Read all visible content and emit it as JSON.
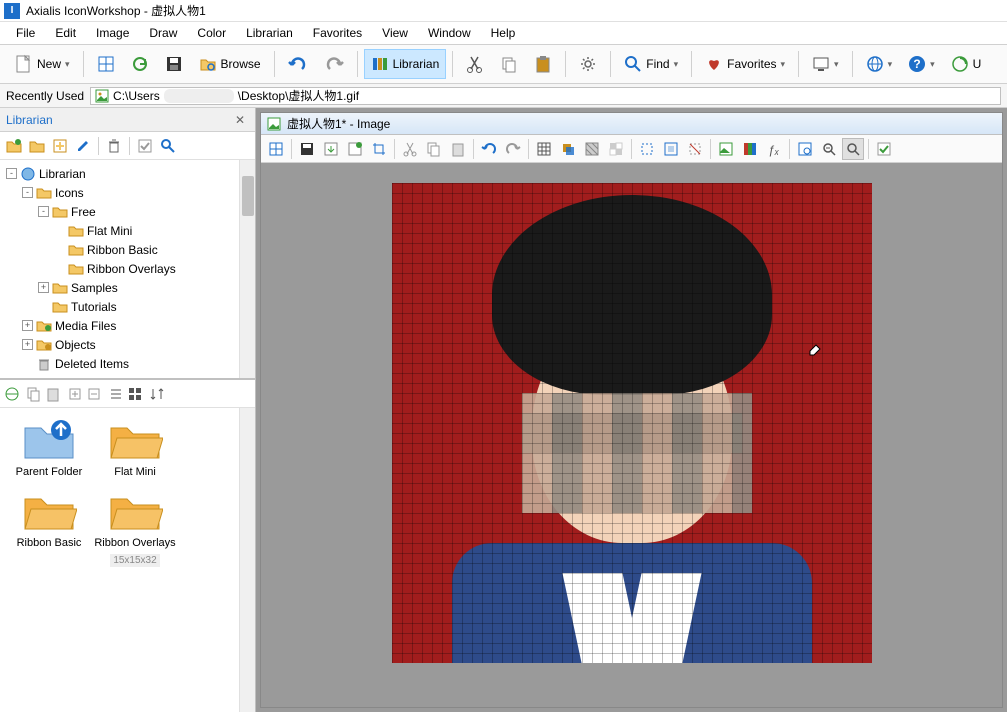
{
  "app": {
    "name": "Axialis IconWorkshop",
    "doc": "虚拟人物1"
  },
  "menu": [
    "File",
    "Edit",
    "Image",
    "Draw",
    "Color",
    "Librarian",
    "Favorites",
    "View",
    "Window",
    "Help"
  ],
  "toolbar": {
    "new": "New",
    "browse": "Browse",
    "librarian": "Librarian",
    "find": "Find",
    "favorites": "Favorites",
    "u_cut": "U"
  },
  "recent": {
    "label": "Recently Used",
    "path_prefix": "C:\\Users",
    "path_suffix": "\\Desktop\\虚拟人物1.gif"
  },
  "librarian": {
    "title": "Librarian",
    "tree": [
      {
        "depth": 0,
        "exp": "-",
        "icon": "lib",
        "label": "Librarian"
      },
      {
        "depth": 1,
        "exp": "-",
        "icon": "fold-y",
        "label": "Icons"
      },
      {
        "depth": 2,
        "exp": "-",
        "icon": "fold-y",
        "label": "Free"
      },
      {
        "depth": 3,
        "exp": "",
        "icon": "fold-y",
        "label": "Flat Mini"
      },
      {
        "depth": 3,
        "exp": "",
        "icon": "fold-y",
        "label": "Ribbon Basic"
      },
      {
        "depth": 3,
        "exp": "",
        "icon": "fold-y",
        "label": "Ribbon Overlays"
      },
      {
        "depth": 2,
        "exp": "+",
        "icon": "fold-y",
        "label": "Samples"
      },
      {
        "depth": 2,
        "exp": "",
        "icon": "fold-y",
        "label": "Tutorials"
      },
      {
        "depth": 1,
        "exp": "+",
        "icon": "fold-g",
        "label": "Media Files"
      },
      {
        "depth": 1,
        "exp": "+",
        "icon": "fold-o",
        "label": "Objects"
      },
      {
        "depth": 1,
        "exp": "",
        "icon": "trash",
        "label": "Deleted Items"
      }
    ],
    "thumbs": [
      {
        "label": "Parent Folder",
        "variant": "parent"
      },
      {
        "label": "Flat Mini",
        "variant": "folder"
      },
      {
        "label": "Ribbon Basic",
        "variant": "folder"
      },
      {
        "label": "Ribbon Overlays",
        "variant": "folder",
        "meta": "15x15x32"
      }
    ]
  },
  "editor": {
    "doc_title": "虚拟人物1* - Image"
  }
}
